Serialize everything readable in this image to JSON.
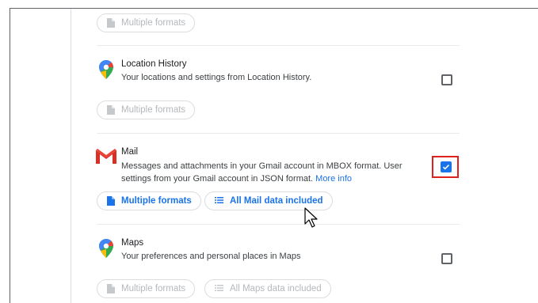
{
  "rows": [
    {
      "chips": [
        {
          "label": "Multiple formats",
          "icon": "file-icon",
          "state": "disabled"
        }
      ]
    },
    {
      "title": "Location History",
      "description": "Your locations and settings from Location History.",
      "icon": "maps-pin-icon",
      "checked": false,
      "chips": [
        {
          "label": "Multiple formats",
          "icon": "file-icon",
          "state": "disabled"
        }
      ]
    },
    {
      "title": "Mail",
      "description_line1": "Messages and attachments in your Gmail account in MBOX format. User",
      "description_line2": "settings from your Gmail account in JSON format.",
      "link": "More info",
      "icon": "gmail-icon",
      "checked": true,
      "chips": [
        {
          "label": "Multiple formats",
          "icon": "file-icon",
          "state": "active"
        },
        {
          "label": "All Mail data included",
          "icon": "list-icon",
          "state": "active"
        }
      ]
    },
    {
      "title": "Maps",
      "description": "Your preferences and personal places in Maps",
      "icon": "maps-pin-icon",
      "checked": false,
      "chips": [
        {
          "label": "Multiple formats",
          "icon": "file-icon",
          "state": "disabled"
        },
        {
          "label": "All Maps data included",
          "icon": "list-icon",
          "state": "disabled"
        }
      ]
    }
  ],
  "colors": {
    "accent": "#1a73e8",
    "highlight": "#e0201c",
    "disabled_text": "#b5b8bc",
    "divider": "#e8eaed"
  }
}
